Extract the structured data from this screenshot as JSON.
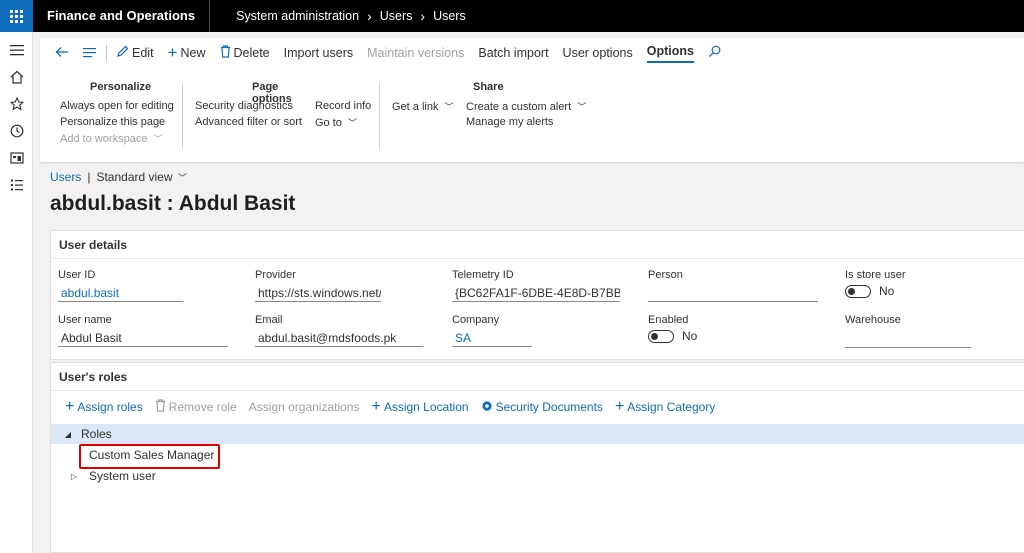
{
  "topbar": {
    "app_name": "Finance and Operations",
    "breadcrumb": [
      "System administration",
      "Users",
      "Users"
    ]
  },
  "toolbar": {
    "edit": "Edit",
    "new": "New",
    "delete": "Delete",
    "import_users": "Import users",
    "maintain_versions": "Maintain versions",
    "batch_import": "Batch import",
    "user_options": "User options",
    "options": "Options"
  },
  "groups": {
    "personalize": {
      "title": "Personalize",
      "items": [
        "Always open for editing",
        "Personalize this page",
        "Add to workspace"
      ]
    },
    "page_options": {
      "title": "Page options",
      "items": [
        "Security diagnostics",
        "Advanced filter or sort",
        "Record info",
        "Go to"
      ]
    },
    "share": {
      "title": "Share",
      "items": [
        "Get a link",
        "Create a custom alert",
        "Manage my alerts"
      ]
    }
  },
  "view": {
    "link": "Users",
    "separator": "|",
    "name": "Standard view"
  },
  "page_title": "abdul.basit : Abdul Basit",
  "user_details": {
    "header": "User details",
    "user_id": {
      "label": "User ID",
      "value": "abdul.basit"
    },
    "provider": {
      "label": "Provider",
      "value": "https://sts.windows.net/"
    },
    "telemetry_id": {
      "label": "Telemetry ID",
      "value": "{BC62FA1F-6DBE-4E8D-B7BB..."
    },
    "person": {
      "label": "Person",
      "value": ""
    },
    "is_store_user": {
      "label": "Is store user",
      "value": "No"
    },
    "user_name": {
      "label": "User name",
      "value": "Abdul Basit"
    },
    "email": {
      "label": "Email",
      "value": "abdul.basit@mdsfoods.pk"
    },
    "company": {
      "label": "Company",
      "value": "SA"
    },
    "enabled": {
      "label": "Enabled",
      "value": "No"
    },
    "warehouse": {
      "label": "Warehouse",
      "value": ""
    }
  },
  "roles": {
    "header": "User's roles",
    "toolbar": {
      "assign_roles": "Assign roles",
      "remove_role": "Remove role",
      "assign_organizations": "Assign organizations",
      "assign_location": "Assign Location",
      "security_documents": "Security Documents",
      "assign_category": "Assign Category"
    },
    "tree": {
      "root": "Roles",
      "children": [
        "Custom Sales Manager",
        "System user"
      ]
    }
  },
  "colors": {
    "accent": "#0f6cbd",
    "highlight": "#e00000",
    "selection": "#dbe7f7"
  }
}
